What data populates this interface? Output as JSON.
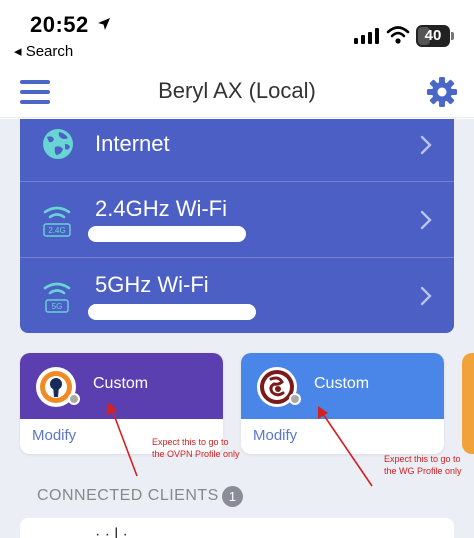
{
  "status_bar": {
    "time": "20:52",
    "back_label": "◂ Search",
    "battery": "40",
    "icons": [
      "location-arrow-icon",
      "signal-icon",
      "wifi-icon",
      "battery-icon"
    ]
  },
  "header": {
    "title": "Beryl AX (Local)",
    "icons": [
      "menu-icon",
      "gear-icon"
    ]
  },
  "networks": [
    {
      "label": "Internet",
      "icon": "globe-icon"
    },
    {
      "label": "2.4GHz Wi-Fi",
      "band": "2.4G",
      "icon": "wifi-icon"
    },
    {
      "label": "5GHz Wi-Fi",
      "band": "5G",
      "icon": "wifi-icon"
    }
  ],
  "vpn_cards": [
    {
      "name": "Custom",
      "action": "Modify",
      "icon": "openvpn-icon",
      "color": "#5b3fb0"
    },
    {
      "name": "Custom",
      "action": "Modify",
      "icon": "wireguard-icon",
      "color": "#4a86e8"
    }
  ],
  "annotations": [
    {
      "line1": "Expect this to go to",
      "line2": "the OVPN Profile only"
    },
    {
      "line1": "Expect this to go to",
      "line2": "the WG Profile only"
    }
  ],
  "clients": {
    "section_label": "CONNECTED CLIENTS",
    "count": "1",
    "first_item_partial": "· ·  l  ·"
  },
  "colors": {
    "accent": "#4a67c8",
    "network_card": "#4b5fc4",
    "icon_teal": "#68d4d4",
    "annotation": "#d42020",
    "side_card": "#f2a23a"
  }
}
